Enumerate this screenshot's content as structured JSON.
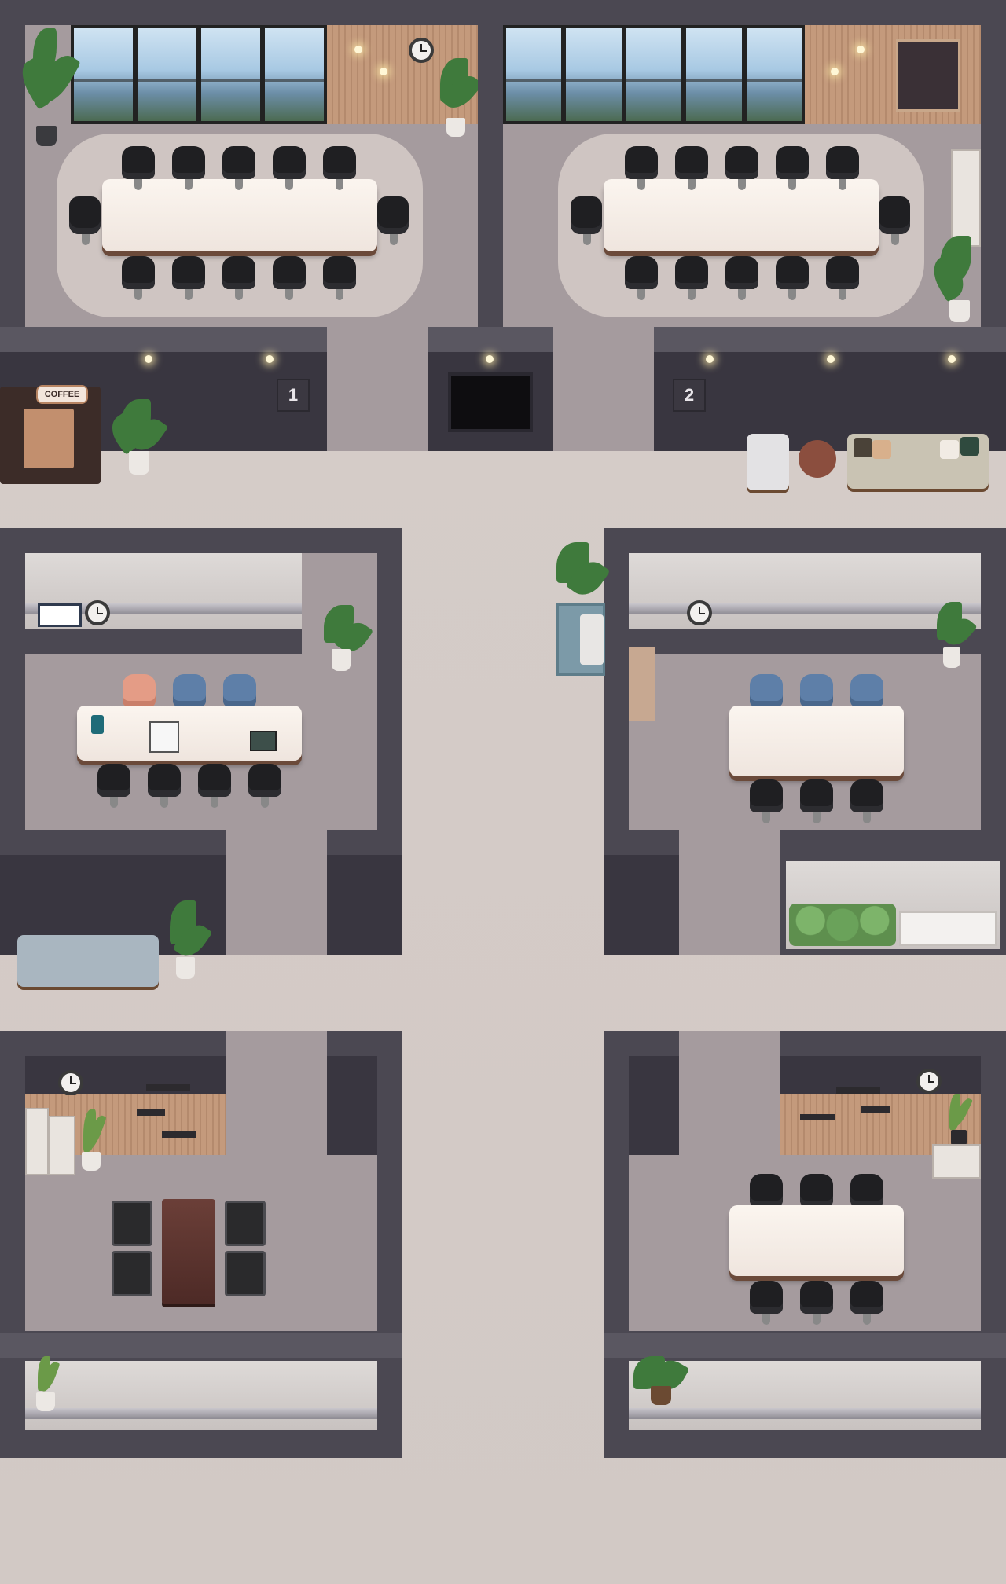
{
  "scene": "office-floor-map",
  "rooms": [
    {
      "id": "meeting-room-1",
      "sign_label": "1"
    },
    {
      "id": "meeting-room-2",
      "sign_label": "2"
    }
  ],
  "coffee_machine": {
    "sign_label": "COFFEE"
  },
  "colors": {
    "wall": "#4b4852",
    "floor": "#a59b9e",
    "hall_floor": "#d6cdc9",
    "table": "#fbf5ef",
    "chair_black": "#1f1f22",
    "chair_blue": "#5e7fa8",
    "chair_pink": "#e49c86",
    "plant_green": "#3f7a3c"
  },
  "icons": [
    "clock-icon",
    "tv-icon",
    "plant-icon",
    "chair-icon",
    "sofa-icon",
    "lamp-icon"
  ]
}
